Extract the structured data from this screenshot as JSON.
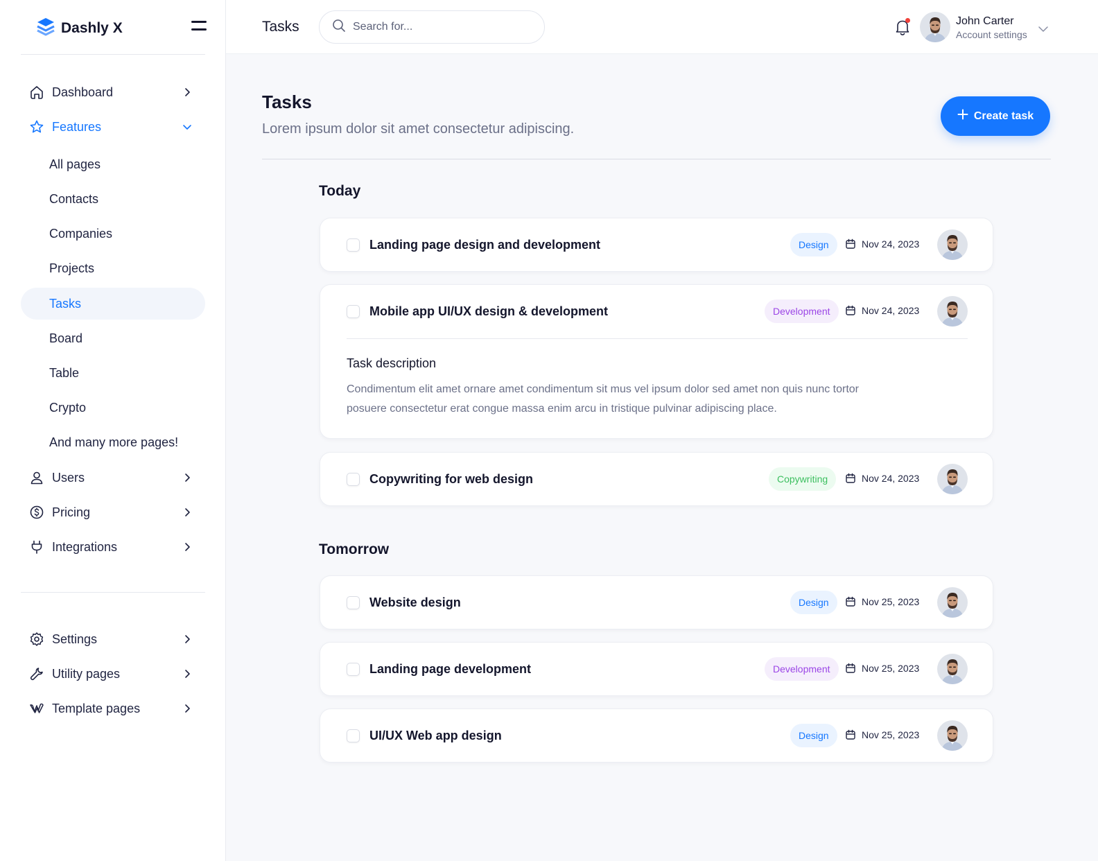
{
  "colors": {
    "accent": "#1677ff",
    "design_tag": "#1677ff",
    "development_tag": "#9b45e6",
    "copywriting_tag": "#3cbf5f",
    "notification_dot": "#f0413a"
  },
  "brand": {
    "name": "Dashly X"
  },
  "sidebar": {
    "main": [
      {
        "label": "Dashboard",
        "icon": "home-icon"
      },
      {
        "label": "Features",
        "icon": "star-icon"
      }
    ],
    "features_sub": [
      {
        "label": "All pages"
      },
      {
        "label": "Contacts"
      },
      {
        "label": "Companies"
      },
      {
        "label": "Projects"
      },
      {
        "label": "Tasks",
        "active": true
      },
      {
        "label": "Board"
      },
      {
        "label": "Table"
      },
      {
        "label": "Crypto"
      },
      {
        "label": "And many more pages!"
      }
    ],
    "more": [
      {
        "label": "Users",
        "icon": "user-icon"
      },
      {
        "label": "Pricing",
        "icon": "dollar-icon"
      },
      {
        "label": "Integrations",
        "icon": "plug-icon"
      }
    ],
    "bottom": [
      {
        "label": "Settings",
        "icon": "gear-icon"
      },
      {
        "label": "Utility pages",
        "icon": "wrench-icon"
      },
      {
        "label": "Template pages",
        "icon": "webflow-icon"
      }
    ]
  },
  "header": {
    "title": "Tasks",
    "search_placeholder": "Search for...",
    "user_name": "John Carter",
    "user_sub": "Account settings"
  },
  "page": {
    "title": "Tasks",
    "subtitle": "Lorem ipsum dolor sit amet consectetur adipiscing.",
    "create_label": "Create task"
  },
  "sections": {
    "today": {
      "title": "Today",
      "tasks": [
        {
          "name": "Landing page design and development",
          "tag": "Design",
          "date": "Nov 24, 2023"
        },
        {
          "name": "Mobile app UI/UX design & development",
          "tag": "Development",
          "date": "Nov 24, 2023",
          "description_title": "Task description",
          "description": "Condimentum elit amet ornare amet condimentum sit mus vel ipsum dolor sed amet non quis nunc tortor posuere consectetur erat congue massa enim arcu in tristique pulvinar adipiscing place."
        },
        {
          "name": "Copywriting for web design",
          "tag": "Copywriting",
          "date": "Nov 24, 2023"
        }
      ]
    },
    "tomorrow": {
      "title": "Tomorrow",
      "tasks": [
        {
          "name": "Website design",
          "tag": "Design",
          "date": "Nov 25, 2023"
        },
        {
          "name": "Landing page development",
          "tag": "Development",
          "date": "Nov 25, 2023"
        },
        {
          "name": "UI/UX Web app design",
          "tag": "Design",
          "date": "Nov 25, 2023"
        }
      ]
    }
  }
}
